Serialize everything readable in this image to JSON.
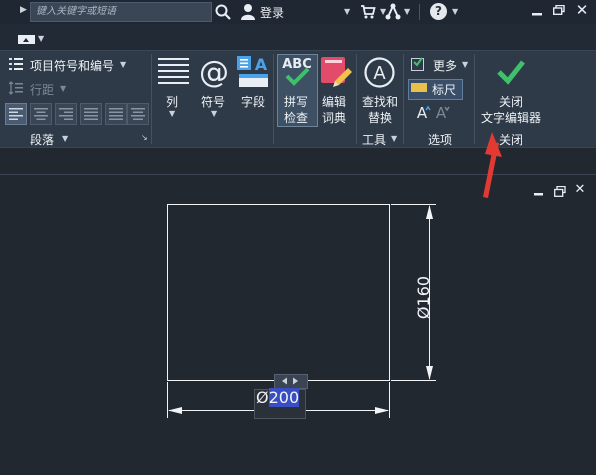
{
  "titlebar": {
    "search_placeholder": "键入关键字或短语",
    "login_label": "登录",
    "help_glyph": "?"
  },
  "ribbon": {
    "paragraph": {
      "bullets_label": "项目符号和编号",
      "line_spacing_label": "行距",
      "title": "段落"
    },
    "insert": {
      "column_label": "列",
      "symbol_label": "符号",
      "field_label": "字段"
    },
    "spell": {
      "check_label_line1": "拼写",
      "check_label_line2": "检查",
      "dict_label_line1": "编辑",
      "dict_label_line2": "词典",
      "abc_text": "ABC"
    },
    "tools": {
      "find_label_line1": "查找和",
      "find_label_line2": "替换",
      "title": "工具"
    },
    "options": {
      "more_label": "更多",
      "ruler_label": "标尺",
      "title": "选项"
    },
    "close": {
      "label_line1": "关闭",
      "label_line2": "文字编辑器",
      "title": "关闭"
    }
  },
  "drawing": {
    "dim_horizontal_prefix": "Ø",
    "dim_horizontal_value": "200",
    "dim_vertical": "Ø160"
  },
  "colors": {
    "annotation_arrow": "#e23a32",
    "accent_check": "#3fc16b",
    "selection": "#3a4ec4"
  }
}
